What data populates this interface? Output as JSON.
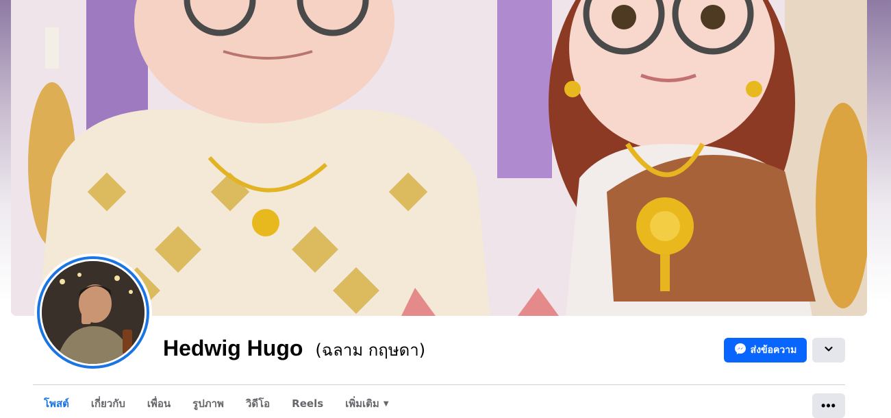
{
  "profile": {
    "name": "Hedwig Hugo",
    "alternate_name": "(ฉลาม กฤษดา)"
  },
  "actions": {
    "message_label": "ส่งข้อความ",
    "message_icon": "messenger-icon",
    "dropdown_icon": "chevron-down-icon",
    "more_icon": "ellipsis-icon",
    "more_label": "•••"
  },
  "tabs": [
    {
      "label": "โพสต์",
      "active": true
    },
    {
      "label": "เกี่ยวกับ",
      "active": false
    },
    {
      "label": "เพื่อน",
      "active": false
    },
    {
      "label": "รูปภาพ",
      "active": false
    },
    {
      "label": "วิดีโอ",
      "active": false
    },
    {
      "label": "Reels",
      "active": false
    },
    {
      "label": "เพิ่มเติม",
      "active": false,
      "dropdown": true
    }
  ],
  "colors": {
    "accent": "#0866ff",
    "active_tab": "#1b74e4",
    "secondary_button": "#e4e6eb",
    "text": "#050505",
    "muted_text": "#65676b"
  }
}
